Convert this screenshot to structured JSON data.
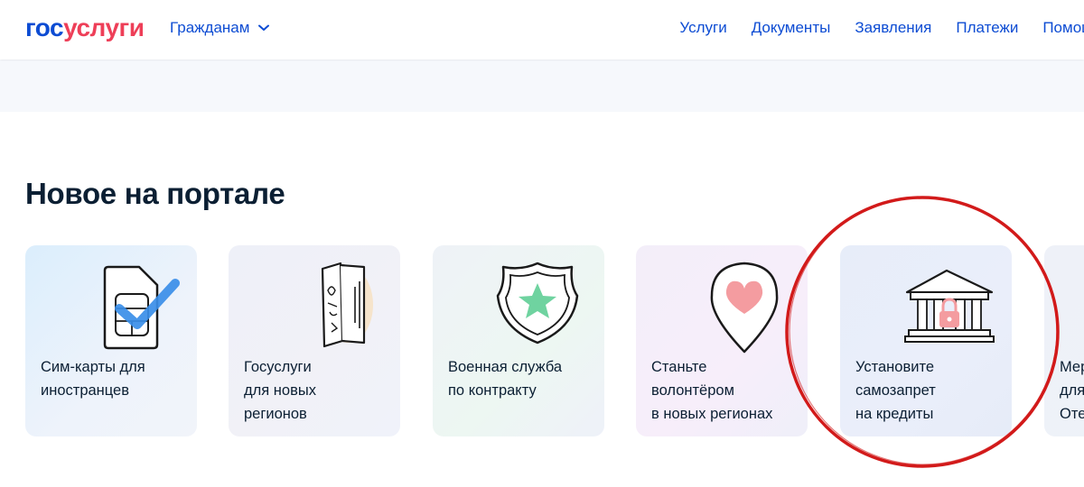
{
  "header": {
    "logo_part1": "гос",
    "logo_part2": "услуги",
    "audience_label": "Гражданам",
    "nav": [
      "Услуги",
      "Документы",
      "Заявления",
      "Платежи",
      "Помощь"
    ]
  },
  "main": {
    "section_title": "Новое на портале",
    "cards": [
      {
        "title": "Сим-карты для\nиностранцев",
        "icon": "sim-card-check-icon"
      },
      {
        "title": "Госуслуги\nдля новых\nрегионов",
        "icon": "passport-book-icon"
      },
      {
        "title": "Военная служба\nпо контракту",
        "icon": "shield-star-icon"
      },
      {
        "title": "Станьте\nволонтёром\nв новых регионах",
        "icon": "heart-pin-icon"
      },
      {
        "title": "Установите\nсамозапрет\nна кредиты",
        "icon": "bank-lock-icon"
      },
      {
        "title": "Мер\nдля\nОте",
        "icon": "partial-card"
      }
    ]
  },
  "colors": {
    "brand_blue": "#0d4cd3",
    "brand_red": "#ee3f58",
    "text_dark": "#0b1f33",
    "highlight_ring": "#d21a1a"
  }
}
